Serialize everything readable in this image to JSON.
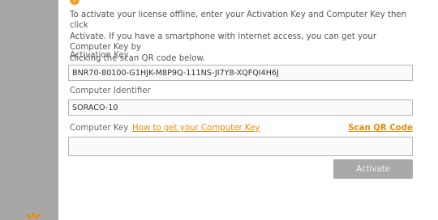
{
  "intro": {
    "line1": "To activate your license offline, enter your Activation Key and Computer Key then click",
    "line2": "Activate. If you have a smartphone with internet access, you can get your Computer Key by",
    "line3": "clicking the scan QR code below."
  },
  "activation_key": {
    "label": "Activation Key",
    "value": "BNR70-80100-G1HJK-M8P9Q-111NS-JI7Y8-XQFQI4H6J"
  },
  "computer_identifier": {
    "label": "Computer Identifier",
    "value": "SORACO-10"
  },
  "computer_key": {
    "label": "Computer Key",
    "help_link": "How to get your Computer Key",
    "scan_link": "Scan QR Code",
    "value": ""
  },
  "actions": {
    "activate": "Activate"
  },
  "colors": {
    "accent": "#e88a0c",
    "sidebar": "#a7a7a7",
    "button_disabled": "#a9a9a9"
  }
}
